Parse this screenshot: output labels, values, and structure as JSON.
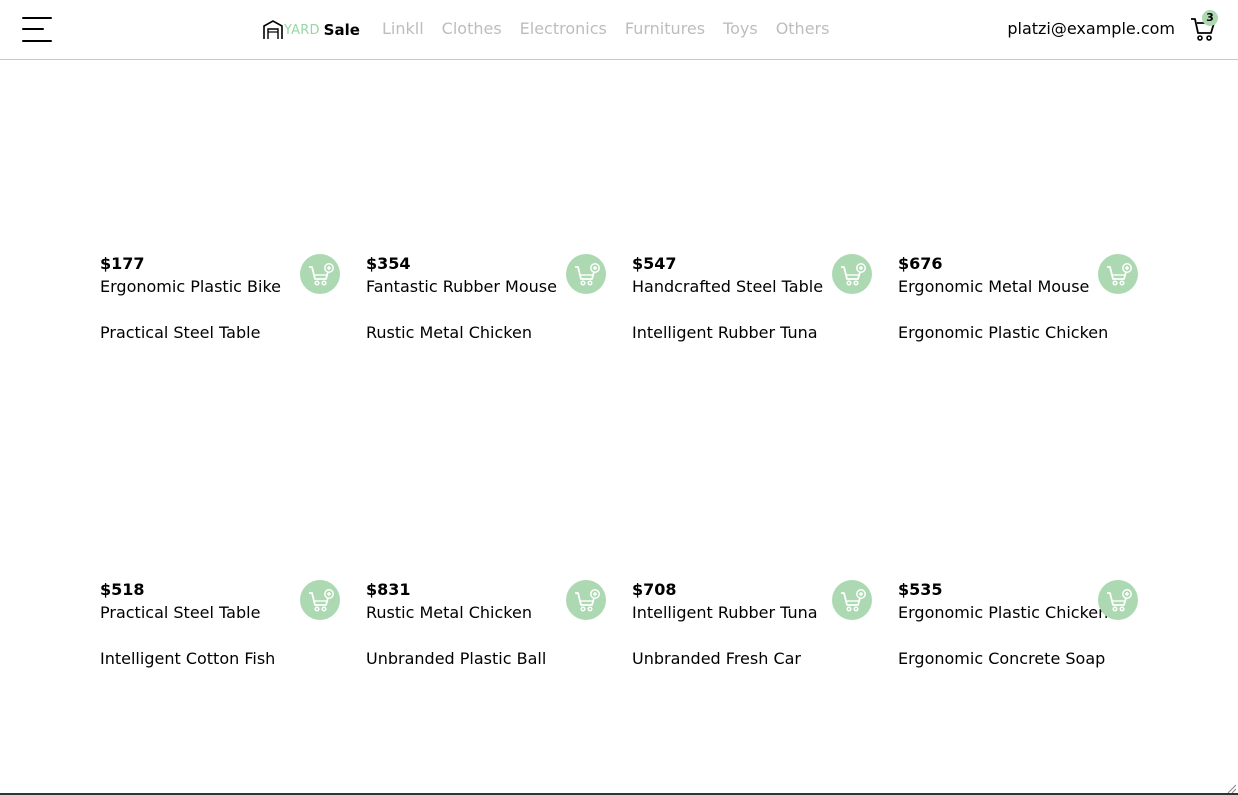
{
  "navbar": {
    "logo_yard": "YARD",
    "logo_sale": "Sale",
    "links": [
      "Linkll",
      "Clothes",
      "Electronics",
      "Furnitures",
      "Toys",
      "Others"
    ],
    "email": "platzi@example.com",
    "cart_count": "3",
    "icons": {
      "menu": "hamburger-menu-icon",
      "logo": "garage-logo-icon",
      "cart": "shopping-cart-icon"
    }
  },
  "colors": {
    "accent": "#acd9b2",
    "logo_green": "#97d7a1",
    "nav_link": "#bdbdbd",
    "border": "#c8c8c8"
  },
  "products": [
    {
      "price": "$177",
      "name": "Ergonomic Plastic Bike",
      "secondary": "Practical Steel Table"
    },
    {
      "price": "$354",
      "name": "Fantastic Rubber Mouse",
      "secondary": "Rustic Metal Chicken"
    },
    {
      "price": "$547",
      "name": "Handcrafted Steel Table",
      "secondary": "Intelligent Rubber Tuna"
    },
    {
      "price": "$676",
      "name": "Ergonomic Metal Mouse",
      "secondary": "Ergonomic Plastic Chicken"
    },
    {
      "price": "$518",
      "name": "Practical Steel Table",
      "secondary": "Intelligent Cotton Fish"
    },
    {
      "price": "$831",
      "name": "Rustic Metal Chicken",
      "secondary": "Unbranded Plastic Ball"
    },
    {
      "price": "$708",
      "name": "Intelligent Rubber Tuna",
      "secondary": "Unbranded Fresh Car"
    },
    {
      "price": "$535",
      "name": "Ergonomic Plastic Chicken",
      "secondary": "Ergonomic Concrete Soap"
    }
  ]
}
